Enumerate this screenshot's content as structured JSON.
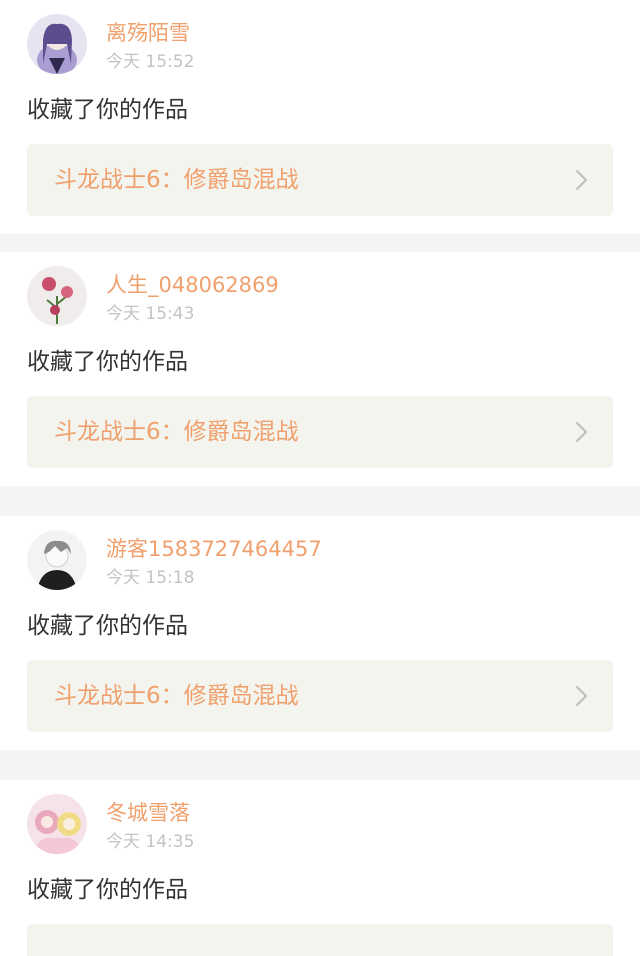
{
  "notifications": [
    {
      "username": "离殇陌雪",
      "time": "今天 15:52",
      "action": "收藏了你的作品",
      "work_title": "斗龙战士6：修爵岛混战",
      "avatar_icon": "anime-girl-purple-avatar-icon",
      "avatar_colors": {
        "bg": "#e7e4f1",
        "fg": "#5c4d8f",
        "accent": "#a99dd1"
      }
    },
    {
      "username": "人生_048062869",
      "time": "今天 15:43",
      "action": "收藏了你的作品",
      "work_title": "斗龙战士6：修爵岛混战",
      "avatar_icon": "pink-flower-avatar-icon",
      "avatar_colors": {
        "bg": "#efeceb",
        "fg": "#c94e69",
        "accent": "#4b7a3c"
      }
    },
    {
      "username": "游客1583727464457",
      "time": "今天 15:18",
      "action": "收藏了你的作品",
      "work_title": "斗龙战士6：修爵岛混战",
      "avatar_icon": "anime-boy-avatar-icon",
      "avatar_colors": {
        "bg": "#f3f3f3",
        "fg": "#1f1f1f",
        "accent": "#8b8b8b"
      }
    },
    {
      "username": "冬城雪落",
      "time": "今天 14:35",
      "action": "收藏了你的作品",
      "work_title": "",
      "avatar_icon": "anime-girls-pastel-avatar-icon",
      "avatar_colors": {
        "bg": "#f6e3ea",
        "fg": "#e9a9bd",
        "accent": "#f0dc86"
      }
    }
  ],
  "colors": {
    "accent": "#f0a06d",
    "time": "#c3c3c3",
    "body_text": "#333333",
    "work_bg": "#f4f4ee",
    "divider_bg": "#f4f4f4"
  }
}
